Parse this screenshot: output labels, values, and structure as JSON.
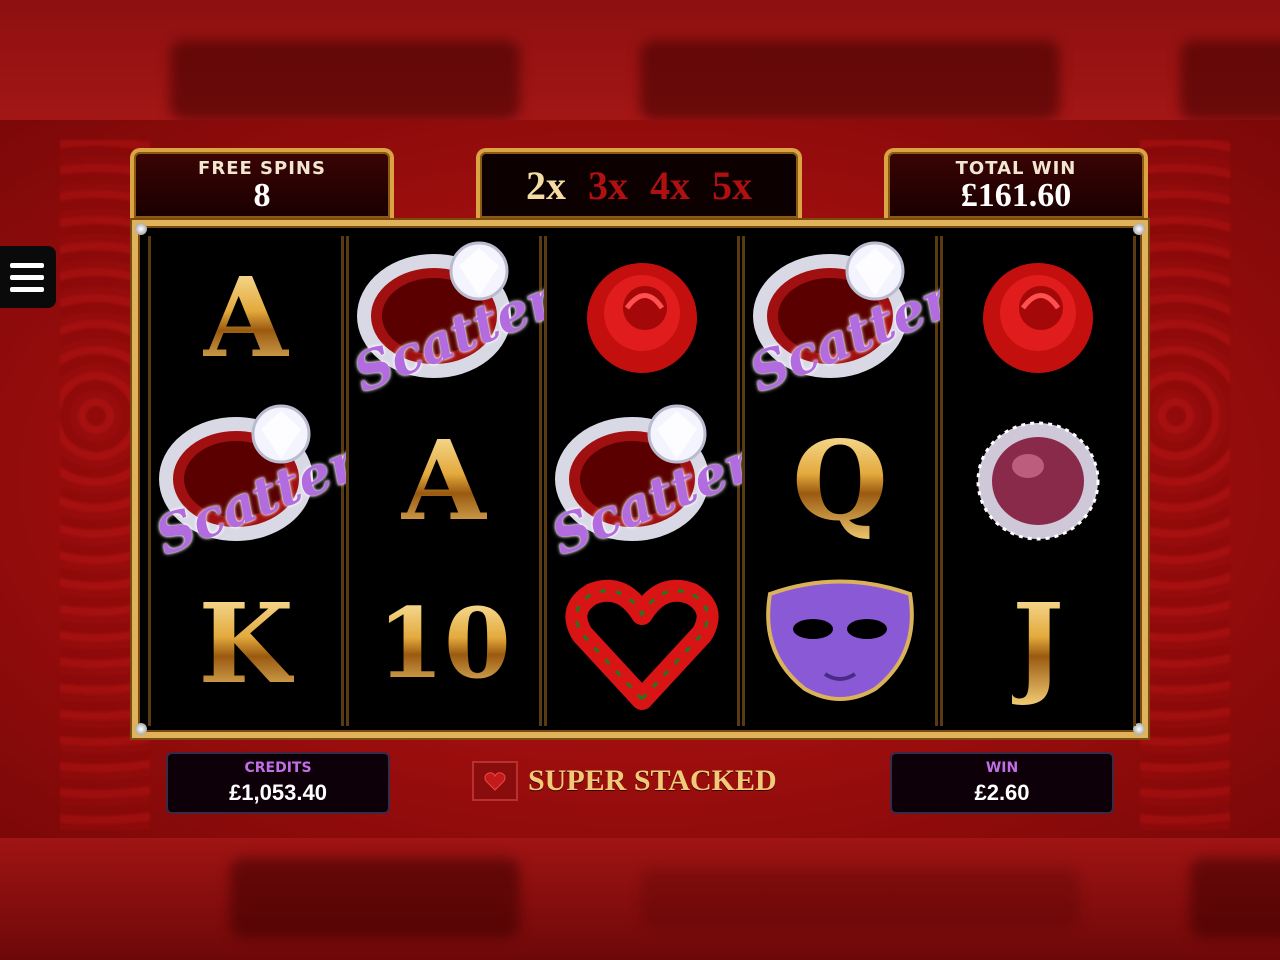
{
  "header": {
    "free_spins": {
      "label": "FREE SPINS",
      "value": "8"
    },
    "multipliers": [
      {
        "label": "2x",
        "active": true
      },
      {
        "label": "3x",
        "active": false
      },
      {
        "label": "4x",
        "active": false
      },
      {
        "label": "5x",
        "active": false
      }
    ],
    "total_win": {
      "label": "TOTAL WIN",
      "value": "£161.60"
    }
  },
  "reels": [
    [
      "A",
      "Scatter",
      "K"
    ],
    [
      "Scatter",
      "A",
      "10"
    ],
    [
      "rose",
      "Scatter",
      "heart"
    ],
    [
      "Scatter",
      "Q",
      "mask"
    ],
    [
      "rose",
      "gem-ring",
      "J"
    ]
  ],
  "scatter_text": "Scatter",
  "footer": {
    "credits": {
      "label": "CREDITS",
      "value": "£1,053.40"
    },
    "feature_label": "SUPER STACKED",
    "win": {
      "label": "WIN",
      "value": "£2.60"
    }
  },
  "colors": {
    "gold": "#e0b35a",
    "scatter_purple": "#b36ce0",
    "background_red": "#a50f0f"
  }
}
